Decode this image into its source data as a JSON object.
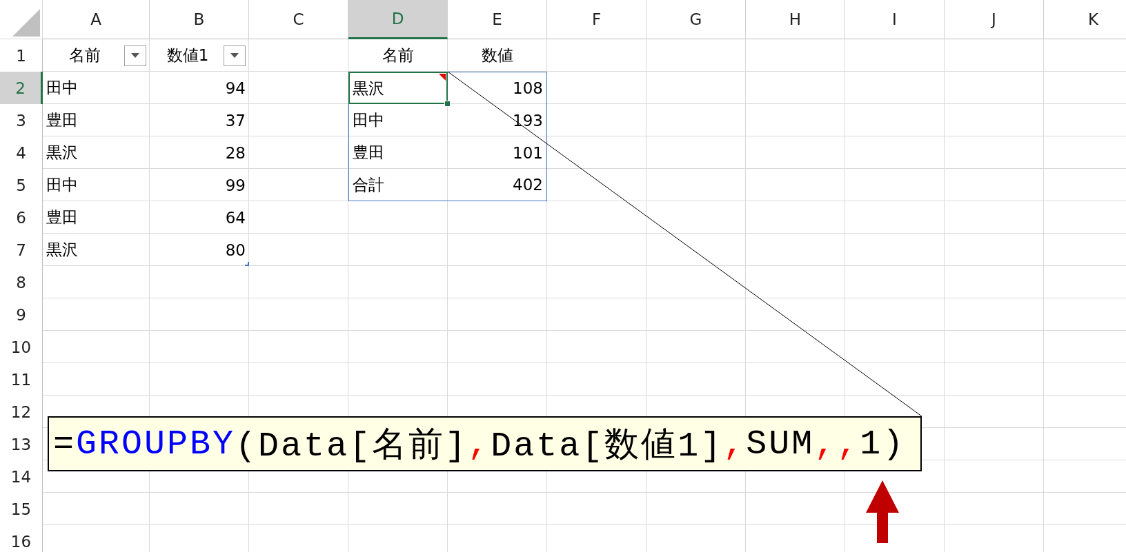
{
  "columns": [
    {
      "label": "A",
      "selected": false
    },
    {
      "label": "B",
      "selected": false
    },
    {
      "label": "C",
      "selected": false
    },
    {
      "label": "D",
      "selected": true
    },
    {
      "label": "E",
      "selected": false
    },
    {
      "label": "F",
      "selected": false
    },
    {
      "label": "G",
      "selected": false
    },
    {
      "label": "H",
      "selected": false
    },
    {
      "label": "I",
      "selected": false
    },
    {
      "label": "J",
      "selected": false
    },
    {
      "label": "K",
      "selected": false
    }
  ],
  "row_headers": [
    {
      "label": "1",
      "selected": false
    },
    {
      "label": "2",
      "selected": true
    },
    {
      "label": "3",
      "selected": false
    },
    {
      "label": "4",
      "selected": false
    },
    {
      "label": "5",
      "selected": false
    },
    {
      "label": "6",
      "selected": false
    },
    {
      "label": "7",
      "selected": false
    },
    {
      "label": "8",
      "selected": false
    },
    {
      "label": "9",
      "selected": false
    },
    {
      "label": "10",
      "selected": false
    },
    {
      "label": "11",
      "selected": false
    },
    {
      "label": "12",
      "selected": false
    },
    {
      "label": "13",
      "selected": false
    },
    {
      "label": "14",
      "selected": false
    },
    {
      "label": "15",
      "selected": false
    },
    {
      "label": "16",
      "selected": false
    }
  ],
  "data_table": {
    "columns": [
      {
        "label": "名前",
        "filter": true
      },
      {
        "label": "数値1",
        "filter": true
      }
    ],
    "rows": [
      [
        "田中",
        "94"
      ],
      [
        "豊田",
        "37"
      ],
      [
        "黒沢",
        "28"
      ],
      [
        "田中",
        "99"
      ],
      [
        "豊田",
        "64"
      ],
      [
        "黒沢",
        "80"
      ]
    ]
  },
  "spill": {
    "columns": [
      {
        "label": "名前"
      },
      {
        "label": "数値"
      }
    ],
    "rows": [
      [
        {
          "text": "黒沢",
          "selected": true,
          "comment": true
        },
        {
          "text": "108",
          "selected": false,
          "comment": false
        }
      ],
      [
        {
          "text": "田中",
          "selected": false,
          "comment": false
        },
        {
          "text": "193",
          "selected": false,
          "comment": false
        }
      ],
      [
        {
          "text": "豊田",
          "selected": false,
          "comment": false
        },
        {
          "text": "101",
          "selected": false,
          "comment": false
        }
      ],
      [
        {
          "text": "合計",
          "selected": false,
          "comment": false
        },
        {
          "text": "402",
          "selected": false,
          "comment": false
        }
      ]
    ]
  },
  "callout": {
    "parts": [
      {
        "text": "=",
        "color": "#000000"
      },
      {
        "text": "GROUPBY",
        "color": "#0000ff"
      },
      {
        "text": "(Data[名前]",
        "color": "#000000"
      },
      {
        "text": ",",
        "color": "#ff0000"
      },
      {
        "text": "Data[数値1]",
        "color": "#000000"
      },
      {
        "text": ",",
        "color": "#ff0000"
      },
      {
        "text": "SUM",
        "color": "#000000"
      },
      {
        "text": ",,",
        "color": "#ff0000"
      },
      {
        "text": "1)",
        "color": "#000000"
      }
    ]
  }
}
